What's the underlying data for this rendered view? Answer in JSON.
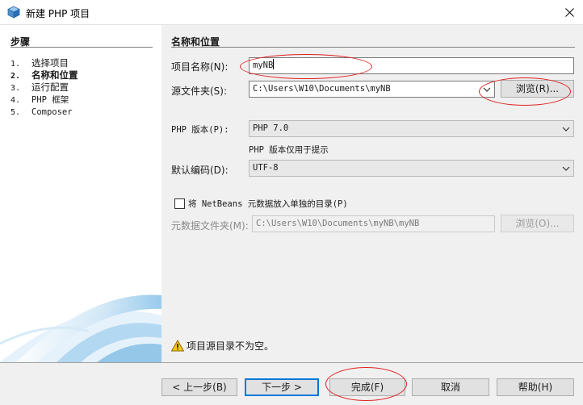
{
  "window": {
    "title": "新建 PHP 项目",
    "icon": "netbeans-cube-icon",
    "close_icon": "close-icon"
  },
  "steps": {
    "heading": "步骤",
    "items": [
      {
        "num": "1.",
        "label": "选择项目",
        "active": false
      },
      {
        "num": "2.",
        "label": "名称和位置",
        "active": true
      },
      {
        "num": "3.",
        "label": "运行配置",
        "active": false
      },
      {
        "num": "4.",
        "label": "PHP 框架",
        "active": false
      },
      {
        "num": "5.",
        "label": "Composer",
        "active": false
      }
    ]
  },
  "main": {
    "heading": "名称和位置",
    "project_name": {
      "label": "项目名称(N):",
      "value": "myNB"
    },
    "sources_folder": {
      "label": "源文件夹(S):",
      "value": "C:\\Users\\W10\\Documents\\myNB",
      "browse_label": "浏览(R)..."
    },
    "php_version": {
      "label": "PHP 版本(P):",
      "value": "PHP 7.0",
      "hint": "PHP 版本仅用于提示"
    },
    "encoding": {
      "label": "默认编码(D):",
      "value": "UTF-8"
    },
    "put_metadata": {
      "label": "将 NetBeans 元数据放入单独的目录(P)",
      "checked": false
    },
    "metadata_folder": {
      "label": "元数据文件夹(M):",
      "value": "C:\\Users\\W10\\Documents\\myNB\\myNB",
      "browse_label": "浏览(O)...",
      "enabled": false
    },
    "warning": {
      "icon": "warning-icon",
      "text": "项目源目录不为空。"
    }
  },
  "buttons": {
    "back": "< 上一步(B)",
    "next": "下一步 >",
    "finish": "完成(F)",
    "cancel": "取消",
    "help": "帮助(H)"
  },
  "colors": {
    "annotation": "#e02020",
    "focus_border": "#0078d7",
    "warning": "#f5c518"
  }
}
